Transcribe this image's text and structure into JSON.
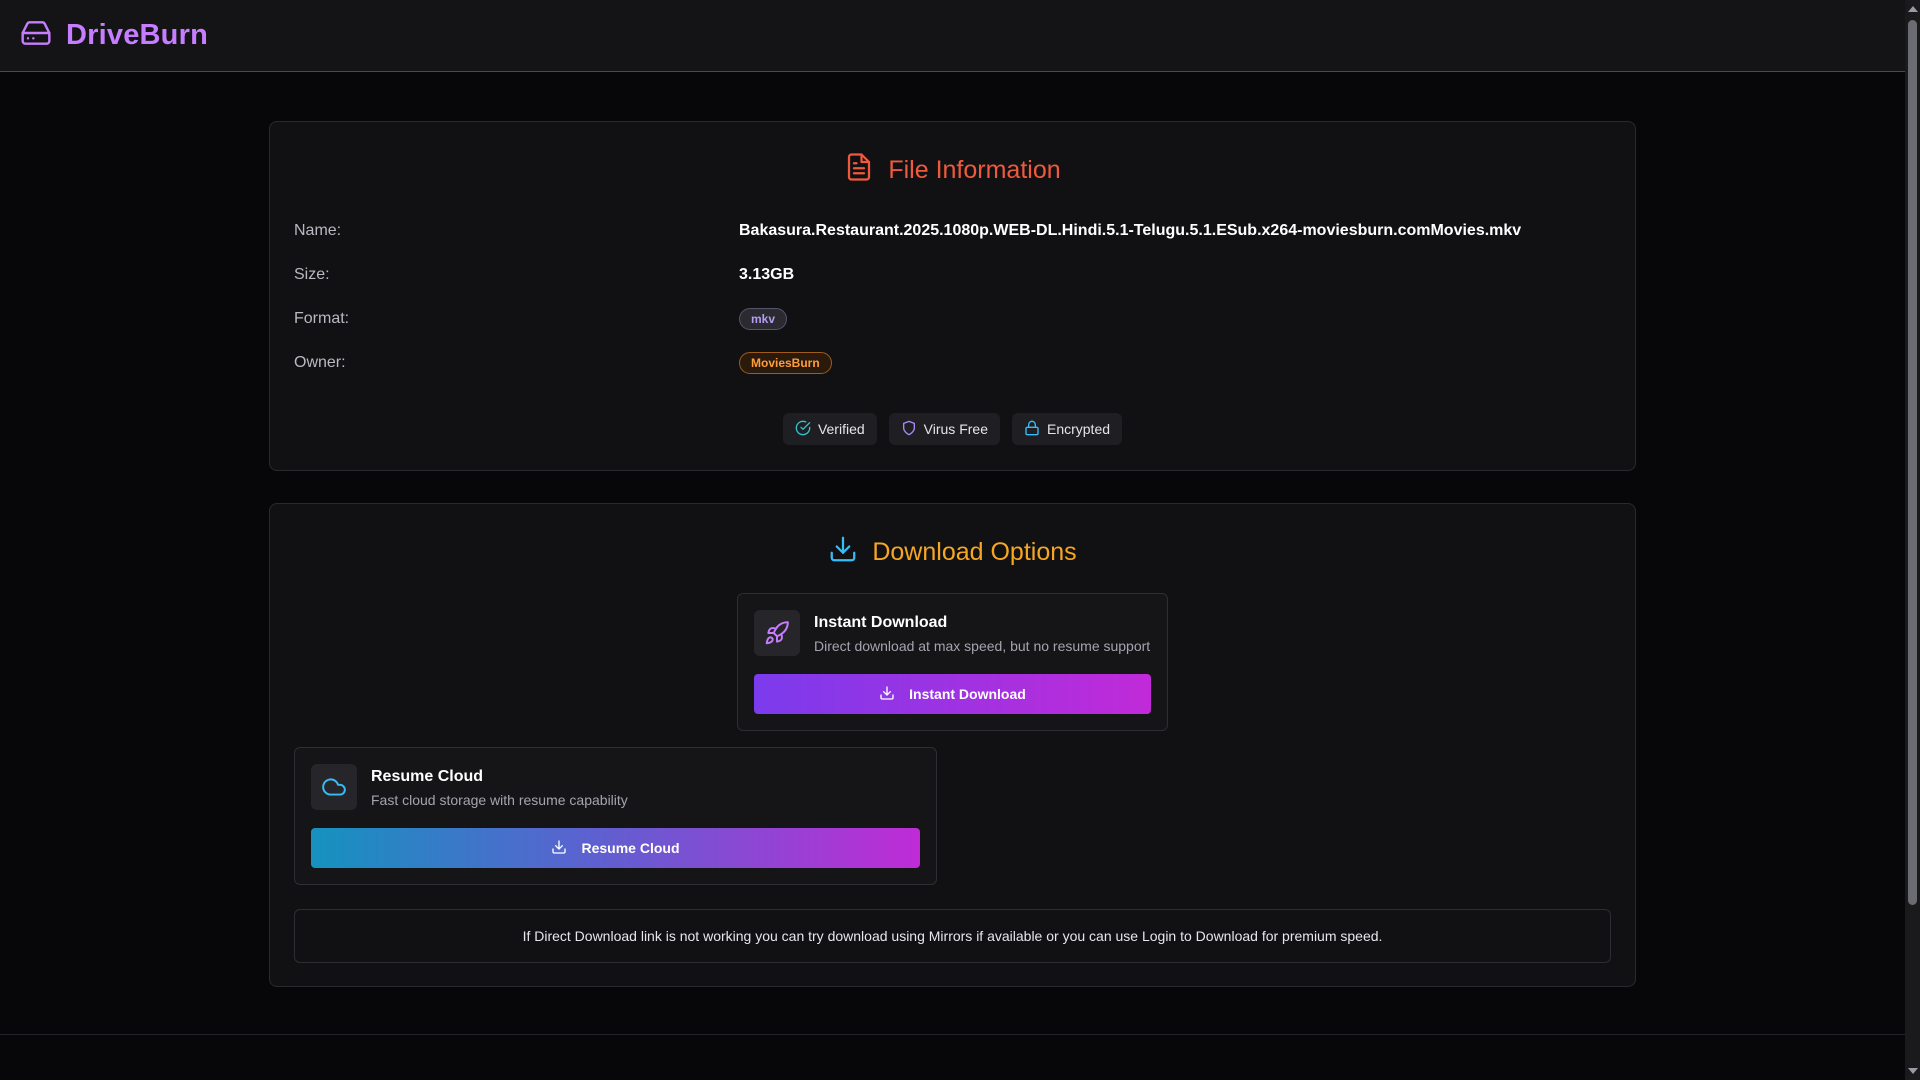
{
  "app": {
    "brand": "DriveBurn"
  },
  "file_info": {
    "title": "File Information",
    "rows": [
      {
        "label": "Name:",
        "value": "Bakasura.Restaurant.2025.1080p.WEB-DL.Hindi.5.1-Telugu.5.1.ESub.x264-moviesburn.comMovies.mkv"
      },
      {
        "label": "Size:",
        "value": "3.13GB"
      },
      {
        "label": "Format:",
        "value": "mkv"
      },
      {
        "label": "Owner:",
        "value": "MoviesBurn"
      }
    ],
    "badges": [
      "Verified",
      "Virus Free",
      "Encrypted"
    ]
  },
  "download": {
    "title": "Download Options",
    "instant": {
      "title": "Instant Download",
      "desc": "Direct download at max speed, but no resume support",
      "button": "Instant Download"
    },
    "cloud": {
      "title": "Resume Cloud",
      "desc": "Fast cloud storage with resume capability",
      "button": "Resume Cloud"
    },
    "note": "If Direct Download link is not working you can try download using Mirrors if available or you can use Login to Download for premium speed."
  },
  "colors": {
    "brand": "#c77dff",
    "info_title": "#ef5a3c",
    "download_title": "#f5a623",
    "owner_badge": "#ff9d3c"
  }
}
